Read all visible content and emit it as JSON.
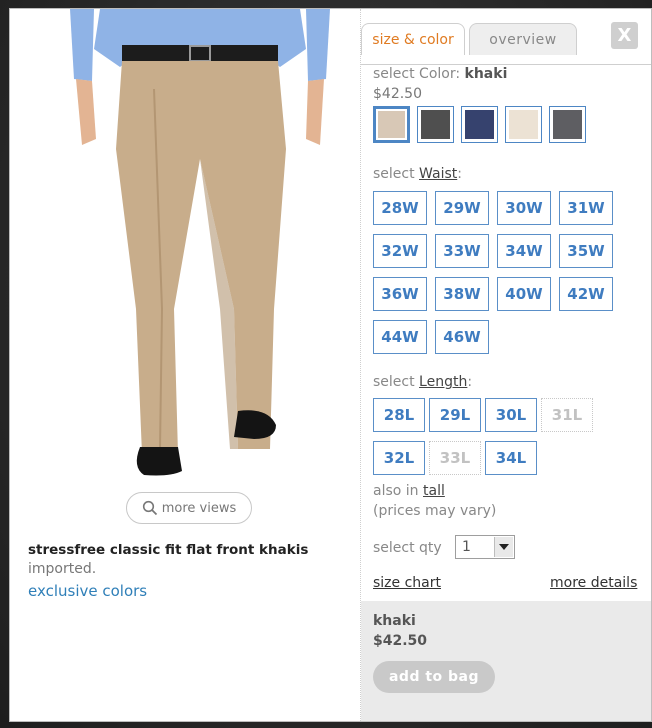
{
  "product": {
    "name": "stressfree classic fit flat front khakis",
    "origin": "imported.",
    "exclusive_link": "exclusive colors",
    "more_views": "more views"
  },
  "tabs": [
    {
      "label": "size & color",
      "active": true
    },
    {
      "label": "overview",
      "active": false
    }
  ],
  "close_label": "X",
  "color": {
    "prefix": "select Color: ",
    "selected_name": "khaki",
    "price": "$42.50",
    "swatches": [
      {
        "name": "khaki",
        "hex": "#d8c8b6",
        "selected": true
      },
      {
        "name": "dark-gray",
        "hex": "#4f4f4f",
        "selected": false
      },
      {
        "name": "navy",
        "hex": "#36426e",
        "selected": false
      },
      {
        "name": "cream",
        "hex": "#ece2d4",
        "selected": false
      },
      {
        "name": "charcoal",
        "hex": "#5e5e62",
        "selected": false
      }
    ]
  },
  "waist": {
    "prefix": "select ",
    "label": "Waist",
    "suffix": ":",
    "sizes": [
      "28W",
      "29W",
      "30W",
      "31W",
      "32W",
      "33W",
      "34W",
      "35W",
      "36W",
      "38W",
      "40W",
      "42W",
      "44W",
      "46W"
    ]
  },
  "length": {
    "prefix": "select ",
    "label": "Length",
    "suffix": ":",
    "sizes": [
      {
        "label": "28L",
        "available": true
      },
      {
        "label": "29L",
        "available": true
      },
      {
        "label": "30L",
        "available": true
      },
      {
        "label": "31L",
        "available": false
      },
      {
        "label": "32L",
        "available": true
      },
      {
        "label": "33L",
        "available": false
      },
      {
        "label": "34L",
        "available": true
      }
    ]
  },
  "also_in": {
    "prefix": "also in ",
    "link": "tall",
    "note": "(prices may vary)"
  },
  "qty": {
    "label": "select qty",
    "value": "1"
  },
  "links": {
    "size_chart": "size chart",
    "more_details": "more details"
  },
  "summary": {
    "color": "khaki",
    "price": "$42.50",
    "button": "add to bag"
  },
  "colors": {
    "accent_orange": "#e07b22",
    "link_blue": "#2f7fb8",
    "size_blue": "#3f7cc0"
  }
}
